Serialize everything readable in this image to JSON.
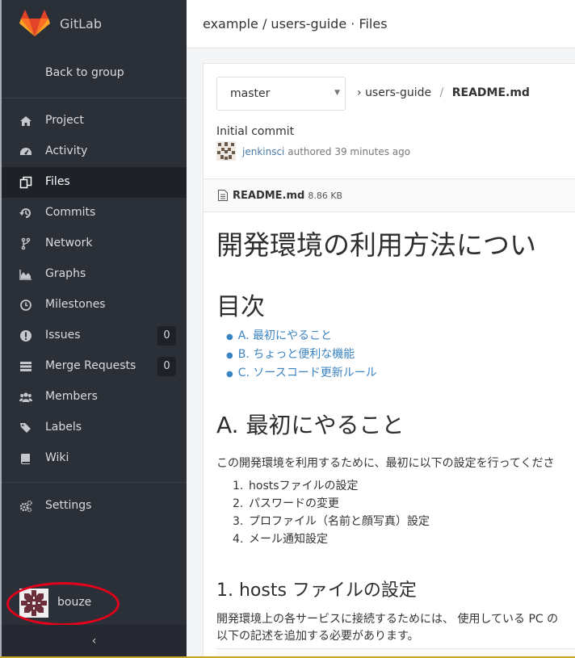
{
  "app": {
    "brand": "GitLab",
    "page_title": "example / users-guide · Files"
  },
  "sidebar": {
    "back_label": "Back to group",
    "items": [
      {
        "label": "Project",
        "icon": "home-icon"
      },
      {
        "label": "Activity",
        "icon": "dashboard-icon"
      },
      {
        "label": "Files",
        "icon": "files-icon",
        "active": true
      },
      {
        "label": "Commits",
        "icon": "history-icon"
      },
      {
        "label": "Network",
        "icon": "code-fork-icon"
      },
      {
        "label": "Graphs",
        "icon": "area-chart-icon"
      },
      {
        "label": "Milestones",
        "icon": "clock-icon"
      },
      {
        "label": "Issues",
        "icon": "exclamation-circle-icon",
        "count": "0"
      },
      {
        "label": "Merge Requests",
        "icon": "tasks-icon",
        "count": "0"
      },
      {
        "label": "Members",
        "icon": "users-icon"
      },
      {
        "label": "Labels",
        "icon": "tags-icon"
      },
      {
        "label": "Wiki",
        "icon": "book-icon"
      }
    ],
    "settings_label": "Settings",
    "user_name": "bouze",
    "collapse_label": "‹"
  },
  "repo": {
    "branch": "master",
    "path_root": "users-guide",
    "path_file": "README.md",
    "commit_message": "Initial commit",
    "commit_author": "jenkinsci",
    "commit_time": "authored 39 minutes ago",
    "file_name": "README.md",
    "file_size": "8.86 KB"
  },
  "readme": {
    "h1": "開発環境の利用方法につい",
    "toc_title": "目次",
    "toc": [
      "A. 最初にやること",
      "B. ちょっと便利な機能",
      "C. ソースコード更新ルール"
    ],
    "section_a_title": "A. 最初にやること",
    "section_a_intro": "この開発環境を利用するために、最初に以下の設定を行ってくださ",
    "steps": [
      {
        "n": "1.",
        "text": "hostsファイルの設定"
      },
      {
        "n": "2.",
        "text": "パスワードの変更"
      },
      {
        "n": "3.",
        "text": "プロファイル（名前と顔写真）設定"
      },
      {
        "n": "4.",
        "text": "メール通知設定"
      }
    ],
    "section_1_title": "1. hosts ファイルの設定",
    "section_1_line1": "開発環境上の各サービスに接続するためには、 使用している PC の",
    "section_1_line2": "以下の記述を追加する必要があります。"
  },
  "colors": {
    "sidebar_bg": "#2b2f37",
    "link": "#3b84c2",
    "highlight_ellipse": "#e3001b"
  }
}
